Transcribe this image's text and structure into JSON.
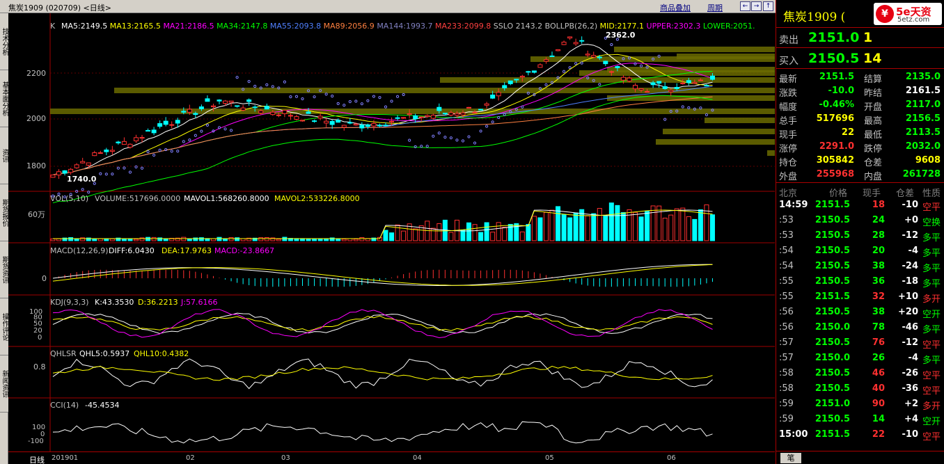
{
  "titlebar": {
    "title": "焦炭1909 (020709) <日线>",
    "link_add": "商品叠加",
    "link_period": "周期",
    "btn_prev": "←",
    "btn_next": "→",
    "btn_up": "↑",
    "btn_down": "↓"
  },
  "sidebar": {
    "tabs": [
      {
        "label": "技术分析"
      },
      {
        "label": "基本面分析"
      },
      {
        "label": "资讯"
      },
      {
        "label": "期货报价"
      },
      {
        "label": "期货资讯"
      },
      {
        "label": "操作评论"
      },
      {
        "label": "新闻资讯"
      }
    ]
  },
  "panels": {
    "main": {
      "label_k": "K",
      "ma": [
        {
          "text": "MA5:2149.5",
          "color": "#ffffff"
        },
        {
          "text": "MA13:2165.5",
          "color": "#ffff00"
        },
        {
          "text": "MA21:2186.5",
          "color": "#ff00ff"
        },
        {
          "text": "MA34:2147.8",
          "color": "#00ff00"
        },
        {
          "text": "MA55:2093.8",
          "color": "#5080ff"
        },
        {
          "text": "MA89:2056.9",
          "color": "#ff8040"
        },
        {
          "text": "MA144:1993.7",
          "color": "#8080c0"
        },
        {
          "text": "MA233:2099.8",
          "color": "#ff4040"
        },
        {
          "text": "SSLO 2143.2",
          "color": "#c0c0c0"
        },
        {
          "text": "BOLLPB(26,2)",
          "color": "#c0c0c0"
        },
        {
          "text": "MID:2177.1",
          "color": "#ffff00"
        },
        {
          "text": "UPPER:2302.3",
          "color": "#ff00ff"
        },
        {
          "text": "LOWER:2051.",
          "color": "#00ff00"
        }
      ],
      "y_labels": [
        "2200",
        "2000",
        "1800"
      ],
      "high_label": "2362.0",
      "low_label": "1740.0"
    },
    "volume": {
      "title": "VOL(5,10)",
      "items": [
        {
          "text": "VOLUME:517696.0000",
          "color": "#c0c0c0"
        },
        {
          "text": "MAVOL1:568260.8000",
          "color": "#ffffff"
        },
        {
          "text": "MAVOL2:533226.8000",
          "color": "#ffff00"
        }
      ],
      "y_label": "60万"
    },
    "macd": {
      "title": "MACD(12,26,9)",
      "items": [
        {
          "text": "DIFF:6.0430",
          "color": "#ffffff"
        },
        {
          "text": "DEA:17.9763",
          "color": "#ffff00"
        },
        {
          "text": "MACD:-23.8667",
          "color": "#ff00ff"
        }
      ],
      "y_label": "0"
    },
    "kdj": {
      "title": "KDJ(9,3,3)",
      "items": [
        {
          "text": "K:43.3530",
          "color": "#ffffff"
        },
        {
          "text": "D:36.2213",
          "color": "#ffff00"
        },
        {
          "text": "J:57.6166",
          "color": "#ff00ff"
        }
      ],
      "y_labels": [
        "100",
        "80",
        "50",
        "20",
        "0"
      ]
    },
    "qhlsr": {
      "title": "QHLSR",
      "items": [
        {
          "text": "QHL5:0.5937",
          "color": "#ffffff"
        },
        {
          "text": "QHL10:0.4382",
          "color": "#ffff00"
        }
      ],
      "y_label": "0.8"
    },
    "cci": {
      "title": "CCI(14)",
      "items": [
        {
          "text": "-45.4534",
          "color": "#ffffff"
        }
      ],
      "y_labels": [
        "100",
        "0",
        "-100"
      ]
    }
  },
  "bottom": {
    "period_label": "日线",
    "x_labels": [
      "201901",
      "02",
      "03",
      "04",
      "05",
      "06"
    ]
  },
  "right": {
    "symbol": "焦炭1909 (",
    "logo_text": "5e天资",
    "logo_url": "5etz.com",
    "sell": {
      "label": "卖出",
      "price": "2151.0",
      "vol": "1"
    },
    "buy": {
      "label": "买入",
      "price": "2150.5",
      "vol": "14"
    },
    "stats": [
      {
        "k1": "最新",
        "v1": "2151.5",
        "c1": "#00ff00",
        "k2": "结算",
        "v2": "2135.0",
        "c2": "#00ff00"
      },
      {
        "k1": "涨跌",
        "v1": "-10.0",
        "c1": "#00ff00",
        "k2": "昨结",
        "v2": "2161.5",
        "c2": "#ffffff"
      },
      {
        "k1": "幅度",
        "v1": "-0.46%",
        "c1": "#00ff00",
        "k2": "开盘",
        "v2": "2117.0",
        "c2": "#00ff00"
      },
      {
        "k1": "总手",
        "v1": "517696",
        "c1": "#ffff00",
        "k2": "最高",
        "v2": "2156.5",
        "c2": "#00ff00"
      },
      {
        "k1": "现手",
        "v1": "22",
        "c1": "#ffff00",
        "k2": "最低",
        "v2": "2113.5",
        "c2": "#00ff00"
      },
      {
        "k1": "涨停",
        "v1": "2291.0",
        "c1": "#ff3030",
        "k2": "跌停",
        "v2": "2032.0",
        "c2": "#00ff00"
      },
      {
        "k1": "持仓",
        "v1": "305842",
        "c1": "#ffff00",
        "k2": "仓差",
        "v2": "9608",
        "c2": "#ffff00"
      },
      {
        "k1": "外盘",
        "v1": "255968",
        "c1": "#ff3030",
        "k2": "内盘",
        "v2": "261728",
        "c2": "#00ff00"
      }
    ],
    "ticks_header": {
      "time": "北京",
      "price": "价格",
      "vol": "现手",
      "oi": "仓差",
      "type": "性质"
    },
    "ticks": [
      {
        "time": "14:59",
        "price": "2151.5",
        "vol": "18",
        "oi": "-10",
        "type": "空平",
        "pc": "#00ff00",
        "vc": "#ff3030",
        "tc": "#ff3030"
      },
      {
        "time": ":53",
        "price": "2150.5",
        "vol": "24",
        "oi": "+0",
        "type": "空换",
        "pc": "#00ff00",
        "vc": "#00ff00",
        "tc": "#00ff00"
      },
      {
        "time": ":53",
        "price": "2150.5",
        "vol": "28",
        "oi": "-12",
        "type": "多平",
        "pc": "#00ff00",
        "vc": "#00ff00",
        "tc": "#00ff00"
      },
      {
        "time": ":54",
        "price": "2150.5",
        "vol": "20",
        "oi": "-4",
        "type": "多平",
        "pc": "#00ff00",
        "vc": "#00ff00",
        "tc": "#00ff00"
      },
      {
        "time": ":54",
        "price": "2150.5",
        "vol": "38",
        "oi": "-24",
        "type": "多平",
        "pc": "#00ff00",
        "vc": "#00ff00",
        "tc": "#00ff00"
      },
      {
        "time": ":55",
        "price": "2150.5",
        "vol": "36",
        "oi": "-18",
        "type": "多平",
        "pc": "#00ff00",
        "vc": "#00ff00",
        "tc": "#00ff00"
      },
      {
        "time": ":55",
        "price": "2151.5",
        "vol": "32",
        "oi": "+10",
        "type": "多开",
        "pc": "#00ff00",
        "vc": "#ff3030",
        "tc": "#ff3030"
      },
      {
        "time": ":56",
        "price": "2150.5",
        "vol": "38",
        "oi": "+20",
        "type": "空开",
        "pc": "#00ff00",
        "vc": "#00ff00",
        "tc": "#00ff00"
      },
      {
        "time": ":56",
        "price": "2150.0",
        "vol": "78",
        "oi": "-46",
        "type": "多平",
        "pc": "#00ff00",
        "vc": "#00ff00",
        "tc": "#00ff00"
      },
      {
        "time": ":57",
        "price": "2150.5",
        "vol": "76",
        "oi": "-12",
        "type": "空平",
        "pc": "#00ff00",
        "vc": "#ff3030",
        "tc": "#ff3030"
      },
      {
        "time": ":57",
        "price": "2150.0",
        "vol": "26",
        "oi": "-4",
        "type": "多平",
        "pc": "#00ff00",
        "vc": "#00ff00",
        "tc": "#00ff00"
      },
      {
        "time": ":58",
        "price": "2150.5",
        "vol": "46",
        "oi": "-26",
        "type": "空平",
        "pc": "#00ff00",
        "vc": "#ff3030",
        "tc": "#ff3030"
      },
      {
        "time": ":58",
        "price": "2150.5",
        "vol": "40",
        "oi": "-36",
        "type": "空平",
        "pc": "#00ff00",
        "vc": "#ff3030",
        "tc": "#ff3030"
      },
      {
        "time": ":59",
        "price": "2151.0",
        "vol": "90",
        "oi": "+2",
        "type": "多开",
        "pc": "#00ff00",
        "vc": "#ff3030",
        "tc": "#ff3030"
      },
      {
        "time": ":59",
        "price": "2150.5",
        "vol": "14",
        "oi": "+4",
        "type": "空开",
        "pc": "#00ff00",
        "vc": "#00ff00",
        "tc": "#00ff00"
      },
      {
        "time": "15:00",
        "price": "2151.5",
        "vol": "22",
        "oi": "-10",
        "type": "空平",
        "pc": "#00ff00",
        "vc": "#ff3030",
        "tc": "#ff3030"
      }
    ],
    "bottom_tab": "笔"
  }
}
